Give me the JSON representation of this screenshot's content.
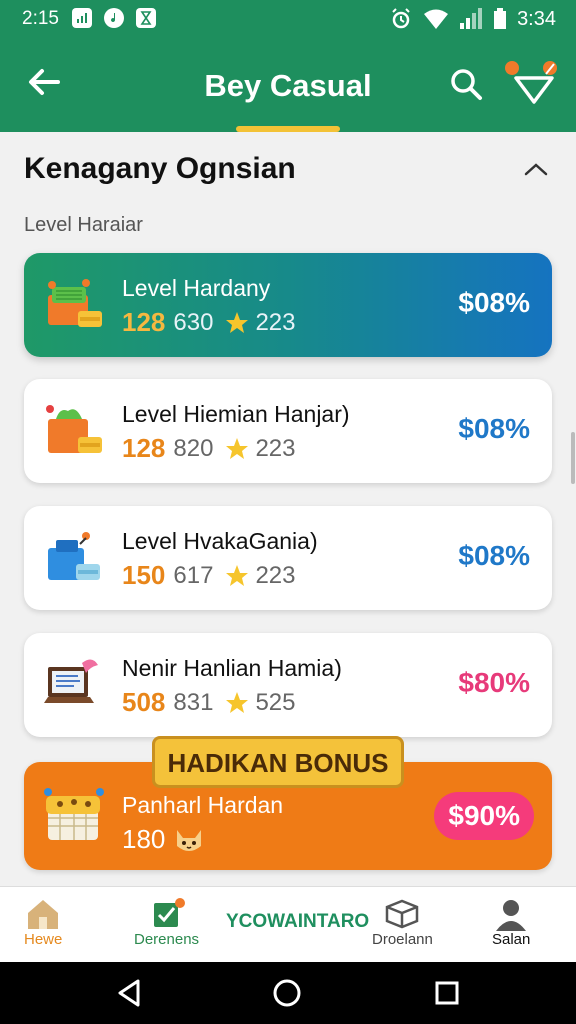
{
  "status_bar": {
    "time_left": "2:15",
    "left_icons": [
      "signal-box",
      "music-note",
      "hourglass"
    ],
    "time_right": "3:34"
  },
  "app_bar": {
    "title": "Bey Casual",
    "icons": [
      "back-arrow-icon",
      "search-icon",
      "filter-icon"
    ]
  },
  "section": {
    "title": "Kenagany Ognsian",
    "subhead": "Level Haraiar"
  },
  "items": [
    {
      "name": "Level Hardany",
      "primary": "128",
      "secondary": "630",
      "third": "223",
      "pct": "$08%"
    },
    {
      "name": "Level Hiemian Hanjar)",
      "primary": "128",
      "secondary": "820",
      "third": "223",
      "pct": "$08%"
    },
    {
      "name": "Level HvakaGania)",
      "primary": "150",
      "secondary": "617",
      "third": "223",
      "pct": "$08%"
    },
    {
      "name": "Nenir Hanlian Hamia)",
      "primary": "508",
      "secondary": "831",
      "third": "525",
      "pct": "$80%"
    }
  ],
  "bonus": {
    "ribbon": "HADIKAN BONUS",
    "name": "Panharl Hardan",
    "stat": "180",
    "pct": "$90%"
  },
  "bottom_nav": {
    "home": "Hewe",
    "dere": "Derenens",
    "center": "YCOWAINTARO",
    "drole": "Droelann",
    "salon": "Salan"
  },
  "colors": {
    "primary_green": "#1e8f5e",
    "accent_yellow": "#f3c236",
    "bonus_orange": "#ef7b16",
    "percent_blue": "#1f78c8",
    "percent_pink": "#e73a7a"
  }
}
